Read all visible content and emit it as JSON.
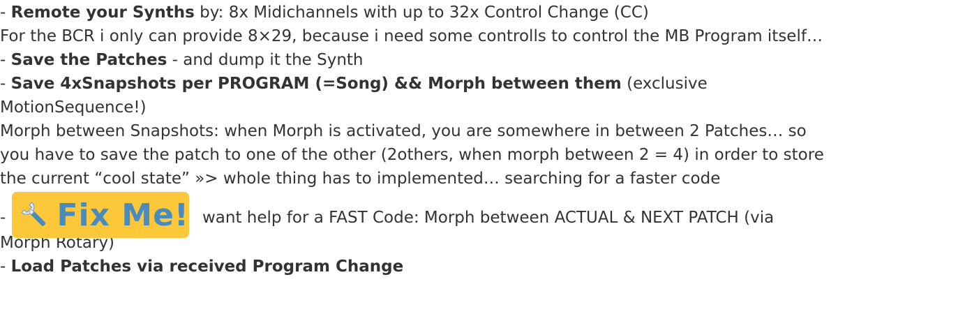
{
  "lines": {
    "l1_dash": "- ",
    "l1_bold": "Remote your Synths",
    "l1_rest": " by: 8x Midichannels with up to 32x Control Change (CC)",
    "l2": "For the BCR i only can provide 8×29, because i need some controlls to control the MB Program itself…",
    "l3_dash": "- ",
    "l3_bold": "Save the Patches",
    "l3_rest": " - and dump it the Synth",
    "l4_dash": "- ",
    "l4_bold": "Save 4xSnapshots per PROGRAM (=Song) && Morph between them",
    "l4_rest": " (exclusive",
    "l5": "MotionSequence!)",
    "l6": "Morph between Snapshots: when Morph is activated, you are somewhere in between 2 Patches… so",
    "l7": "you have to save the patch to one of the other (2others, when morph between 2 = 4) in order to store",
    "l8": "the current “cool state” »> whole thing has to implemented… searching for a faster code",
    "fixme_dash": "-",
    "fixme_label": "Fix Me!",
    "fixme_rest": "want help for a FAST Code: Morph between ACTUAL & NEXT PATCH (via",
    "l10": "Morph Rotary)",
    "l11_dash": "- ",
    "l11_bold": "Load Patches via received Program Change"
  },
  "colors": {
    "text": "#333333",
    "fixme_bg": "#fcc83a",
    "fixme_text": "#4a8bbd"
  },
  "icons": {
    "fixme": "wrench-icon"
  }
}
